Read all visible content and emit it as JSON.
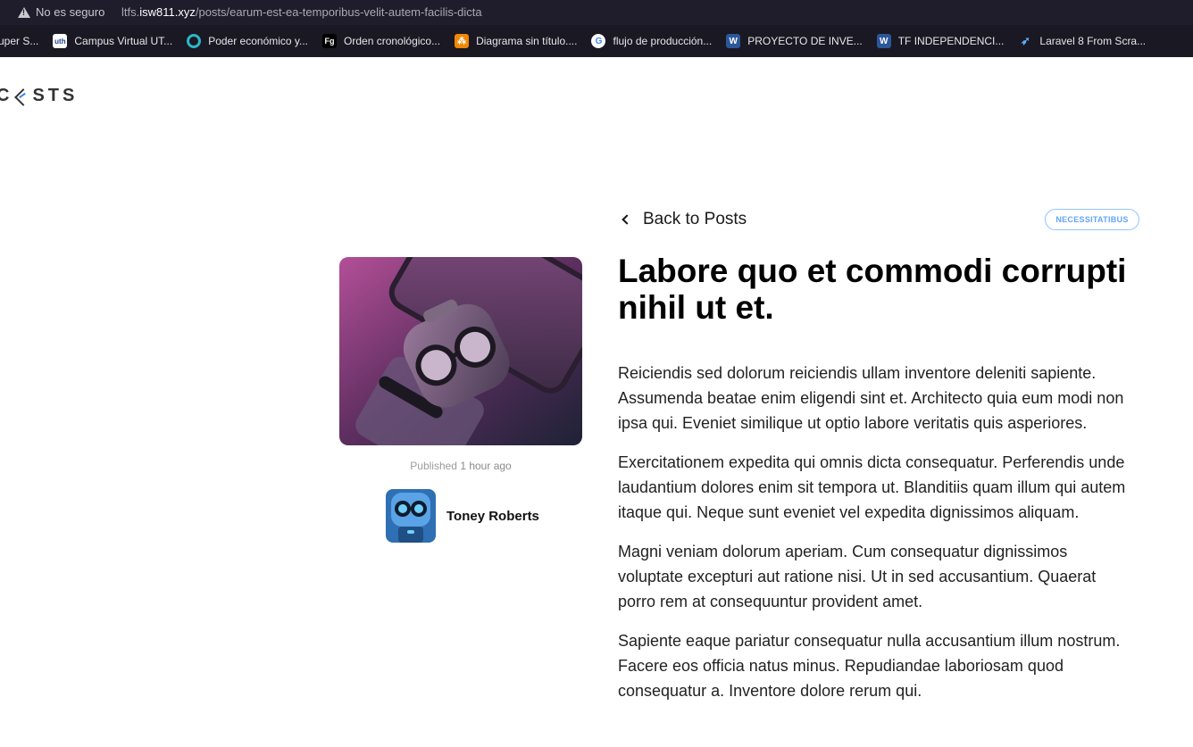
{
  "browser": {
    "security_label": "No es seguro",
    "url_prefix": "ltfs.",
    "url_host": "isw811.xyz",
    "url_path": "/posts/earum-est-ea-temporibus-velit-autem-facilis-dicta"
  },
  "bookmarks": [
    {
      "label": "uper S...",
      "icon": "bookmark-icon"
    },
    {
      "label": "Campus Virtual UT...",
      "icon": "uth-icon"
    },
    {
      "label": "Poder económico y...",
      "icon": "geo-icon"
    },
    {
      "label": "Orden cronológico...",
      "icon": "fg-icon"
    },
    {
      "label": "Diagrama sin título....",
      "icon": "drawio-icon"
    },
    {
      "label": "flujo de producción...",
      "icon": "google-icon"
    },
    {
      "label": "PROYECTO DE INVE...",
      "icon": "word-icon"
    },
    {
      "label": "TF INDEPENDENCI...",
      "icon": "word-icon"
    },
    {
      "label": "Laravel 8 From Scra...",
      "icon": "plane-icon"
    }
  ],
  "site": {
    "logo_left": "C",
    "logo_right": "STS"
  },
  "post": {
    "back_label": "Back to Posts",
    "category": "NECESSITATIBUS",
    "title": "Labore quo et commodi corrupti nihil ut et.",
    "published_label": "Published",
    "published_time": "1 hour ago",
    "author": "Toney Roberts",
    "paragraphs": [
      "Reiciendis sed dolorum reiciendis ullam inventore deleniti sapiente. Assumenda beatae enim eligendi sint et. Architecto quia eum modi non ipsa qui. Eveniet similique ut optio labore veritatis quis asperiores.",
      "Exercitationem expedita qui omnis dicta consequatur. Perferendis unde laudantium dolores enim sit tempora ut. Blanditiis quam illum qui autem itaque qui. Neque sunt eveniet vel expedita dignissimos aliquam.",
      "Magni veniam dolorum aperiam. Cum consequatur dignissimos voluptate excepturi aut ratione nisi. Ut in sed accusantium. Quaerat porro rem at consequuntur provident amet.",
      "Sapiente eaque pariatur consequatur nulla accusantium illum nostrum. Facere eos officia natus minus. Repudiandae laboriosam quod consequatur a. Inventore dolore rerum qui."
    ]
  },
  "colors": {
    "accent": "#60a5fa",
    "browser_bar": "#1f1d2b"
  }
}
